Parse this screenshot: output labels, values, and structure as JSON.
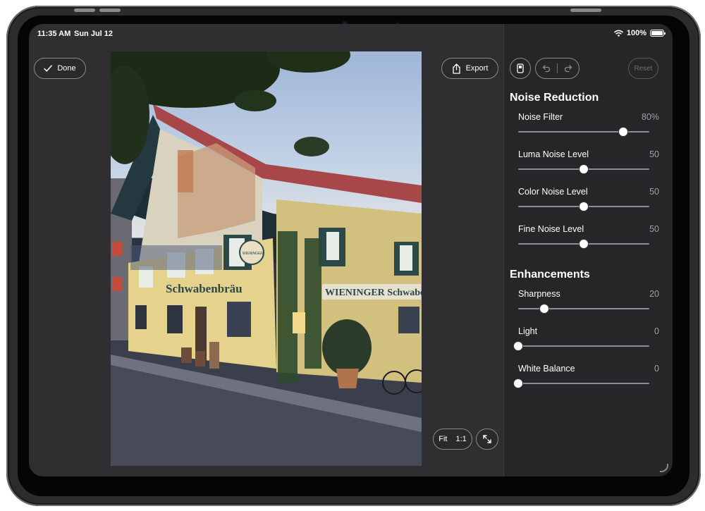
{
  "status_bar": {
    "time": "11:35 AM",
    "date": "Sun Jul 12",
    "battery": "100%"
  },
  "toolbar": {
    "done_label": "Done",
    "export_label": "Export",
    "reset_label": "Reset"
  },
  "zoom": {
    "fit_label": "Fit",
    "actual_label": "1:1"
  },
  "photo": {
    "sign_main": "Schwabenbräu",
    "sign_side": "WIENINGER Schwabenbräu",
    "sign_round": "WIENINGER"
  },
  "noise_reduction": {
    "title": "Noise Reduction",
    "sliders": [
      {
        "label": "Noise Filter",
        "value": "80%",
        "fraction": 0.8
      },
      {
        "label": "Luma Noise Level",
        "value": "50",
        "fraction": 0.5
      },
      {
        "label": "Color Noise Level",
        "value": "50",
        "fraction": 0.5
      },
      {
        "label": "Fine Noise Level",
        "value": "50",
        "fraction": 0.5
      }
    ]
  },
  "enhancements": {
    "title": "Enhancements",
    "sliders": [
      {
        "label": "Sharpness",
        "value": "20",
        "fraction": 0.2
      },
      {
        "label": "Light",
        "value": "0",
        "fraction": 0.0
      },
      {
        "label": "White Balance",
        "value": "0",
        "fraction": 0.0
      }
    ]
  },
  "icons": {
    "done": "checkmark-icon",
    "export": "share-icon",
    "compare": "compare-icon",
    "undo": "undo-icon",
    "redo": "redo-icon",
    "fullscreen": "expand-icon"
  },
  "colors": {
    "panel_bg": "#262628",
    "canvas_bg": "#2f2f31",
    "accent": "#ffffff"
  }
}
